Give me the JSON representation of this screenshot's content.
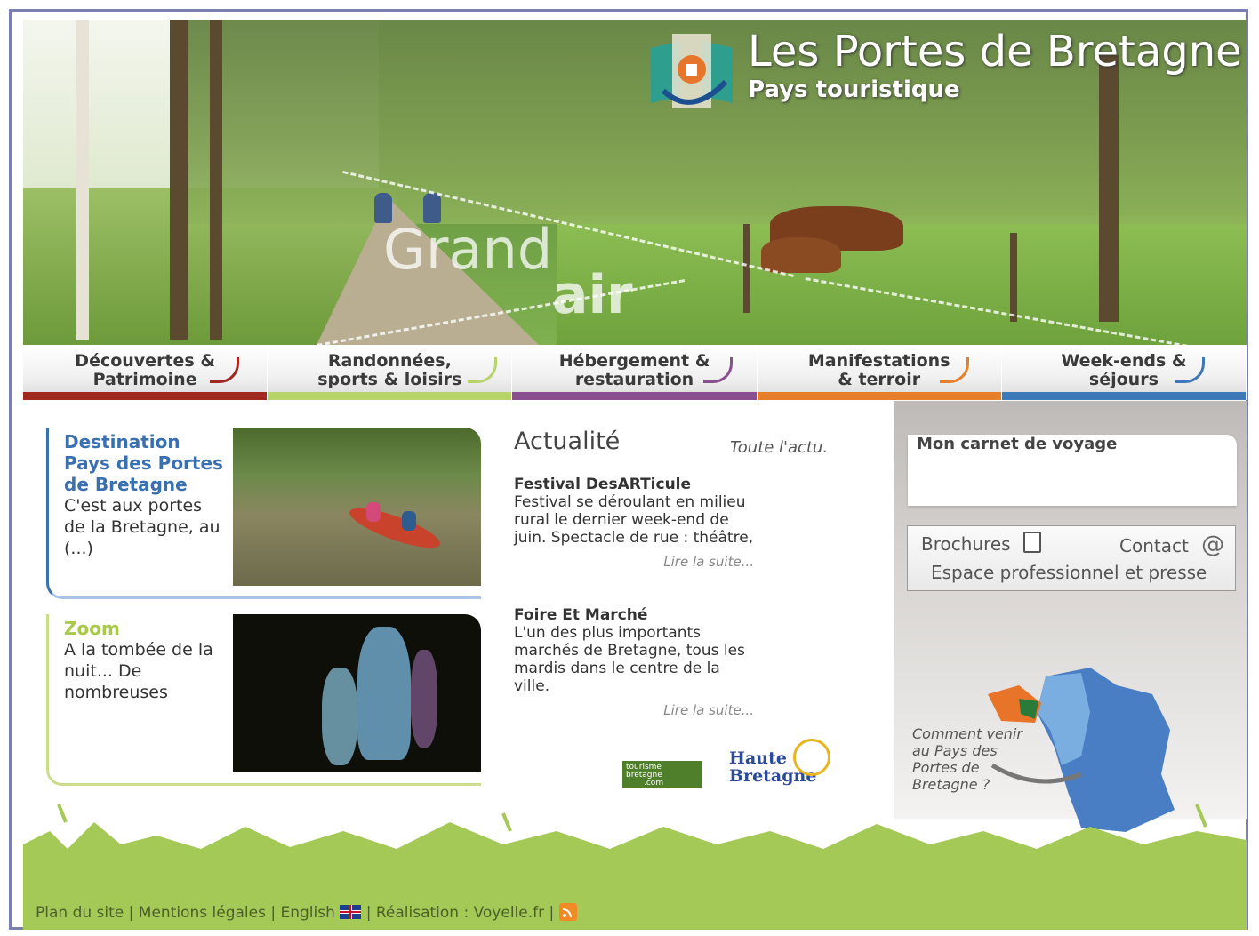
{
  "header": {
    "site_title": "Les Portes de Bretagne",
    "site_subtitle": "Pays touristique",
    "overlay_word1": "Grand",
    "overlay_word2": "air"
  },
  "nav": [
    {
      "label": "Découvertes &\nPatrimoine",
      "color": "#a0281e"
    },
    {
      "label": "Randonnées,\nsports & loisirs",
      "color": "#b7d36b"
    },
    {
      "label": "Hébergement &\nrestauration",
      "color": "#8a4f8f"
    },
    {
      "label": "Manifestations\n& terroir",
      "color": "#e67e2a"
    },
    {
      "label": "Week-ends &\nséjours",
      "color": "#3f78b7"
    }
  ],
  "cards": [
    {
      "title": "Destination Pays des Portes de Bretagne",
      "body": "C'est aux portes de la Bretagne, au (...)",
      "title_color": "#3a6fb0"
    },
    {
      "title": "Zoom",
      "body": "A la tombée de la nuit... De nombreuses",
      "title_color": "#a8c94a"
    }
  ],
  "actualite": {
    "title": "Actualité",
    "all_link": "Toute l'actu.",
    "items": [
      {
        "title": "Festival DesARTicule",
        "text": "Festival se déroulant en milieu rural le dernier week-end de juin. Spectacle de rue : théâtre,",
        "more": "Lire la suite..."
      },
      {
        "title": "Foire Et Marché",
        "text": "L'un des plus importants marchés de Bretagne, tous les mardis dans le centre de la ville.",
        "more": "Lire la suite..."
      }
    ]
  },
  "partners": {
    "p1_line1": "tourisme",
    "p1_line2": "bretagne",
    "p1_line3": ".com",
    "p2_line1": "Haute",
    "p2_line2": "Bretagne"
  },
  "sidebar": {
    "carnet_title": "Mon carnet de voyage",
    "brochures": "Brochures",
    "contact": "Contact",
    "espace": "Espace professionnel et presse",
    "comment": "Comment venir au Pays des Portes de Bretagne ?"
  },
  "footer": {
    "plan": "Plan du site",
    "mentions": "Mentions légales",
    "english": "English",
    "realisation": "Réalisation : Voyelle.fr",
    "sep": "|"
  }
}
